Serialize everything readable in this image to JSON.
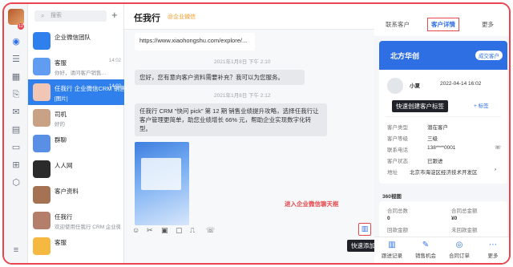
{
  "rail": {
    "badge": "12",
    "icons": [
      "chat-icon",
      "contacts-icon",
      "calendar-icon",
      "docs-icon",
      "mail-icon",
      "workbench-icon",
      "bookmark-icon",
      "grid-icon",
      "cube-icon",
      "settings-icon"
    ]
  },
  "list": {
    "search_placeholder": "搜索",
    "plus_label": "+",
    "items": [
      {
        "name": "企业微信团队",
        "preview": "",
        "time": "",
        "avatar_color": "#2f80ed",
        "selected": false
      },
      {
        "name": "客服",
        "preview": "你好，请问客户销售…",
        "time": "14:02",
        "avatar_color": "#5f9cf2",
        "selected": false
      },
      {
        "name": "任我行 企业微信CRM 销售",
        "preview": "[图片]",
        "time": "14:02",
        "avatar_color": "#f1c6b4",
        "selected": true
      },
      {
        "name": "司机",
        "preview": "好的",
        "time": "",
        "avatar_color": "#c9a184",
        "selected": false
      },
      {
        "name": "群聊",
        "preview": "",
        "time": "",
        "avatar_color": "#5a8fe6",
        "selected": false
      },
      {
        "name": "人人网",
        "preview": "",
        "time": "",
        "avatar_color": "#2b2b2b",
        "selected": false
      },
      {
        "name": "客户资料",
        "preview": "",
        "time": "",
        "avatar_color": "#a57354",
        "selected": false
      },
      {
        "name": "任我行 ",
        "preview": "欢迎使用任我行 CRM 企业微信",
        "time": "",
        "avatar_color": "#b47e6a",
        "selected": false
      },
      {
        "name": "客服",
        "preview": "",
        "time": "",
        "avatar_color": "#f5b841",
        "selected": false
      }
    ]
  },
  "chat": {
    "title": "任我行",
    "title_tag": "@企业微信",
    "link_preview": "https://www.xiaohongshu.com/explore/...",
    "time1": "2021年1月8日 下午 2:10",
    "msg1": "您好，您有意向客户资料需要补充？我可以为您服务。",
    "time2": "2021年1月8日 下午 2:12",
    "msg2": "任我行 CRM \"快问 pick\" 第 12 期 销售业绩提升攻略，选择任我行让客户管理更简单，助您业绩增长 66% 元，帮助企业实现数字化转型。",
    "note_enter": "进入企业微信聊天框",
    "callout_add": "快速添加跟进记录",
    "toolbar_icons": [
      "emoji-icon",
      "scissors-icon",
      "image-icon",
      "file-icon",
      "clip-icon",
      "phone-icon"
    ]
  },
  "panel": {
    "tabs": [
      "联系客户",
      "客户详情",
      "更多"
    ],
    "active_tab": 1,
    "company": "北方华创",
    "pill": "成交客户",
    "callout_tag": "快速创建客户标签",
    "contact_name": "小夏",
    "created_time": "2022-04-14 16:02",
    "add_tag": "+ 标签",
    "fields": [
      {
        "label": "客户类型",
        "value": "潜在客户"
      },
      {
        "label": "客户等级",
        "value": "三级"
      },
      {
        "label": "联系电话",
        "value": "138****0001"
      },
      {
        "label": "客户状态",
        "value": "已跟进"
      },
      {
        "label": "地址",
        "value": "北京市海淀区经济技术开发区"
      }
    ],
    "section_title": "360视图",
    "stats": [
      {
        "label": "合同总数",
        "value": "0"
      },
      {
        "label": "合同总金额",
        "value": "¥0"
      },
      {
        "label": "回款金额",
        "value": "¥0"
      },
      {
        "label": "未回款金额",
        "value": "¥0"
      }
    ],
    "bottom_tabs": [
      "跟进记录",
      "销售机会",
      "合同订单",
      "更多"
    ]
  }
}
